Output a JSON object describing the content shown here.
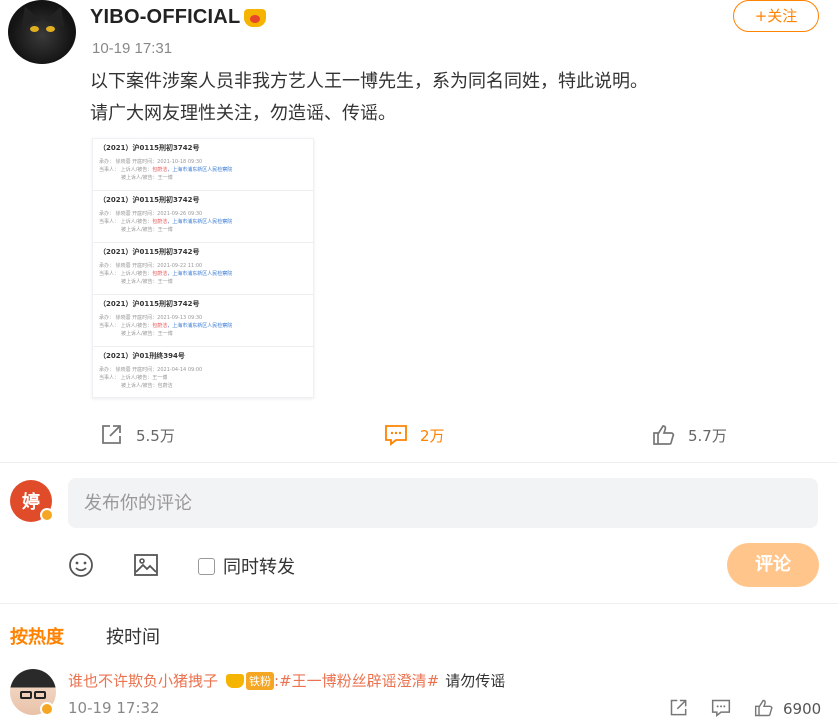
{
  "post": {
    "author": "YIBO-OFFICIAL",
    "time": "10-19 17:31",
    "follow_label": "+关注",
    "text_line1": "以下案件涉案人员非我方艺人王一博先生，系为同名同姓，特此说明。",
    "text_line2": "请广大网友理性关注，勿造谣、传谣。",
    "cases": [
      {
        "title": "（2021）沪0115刑初3742号",
        "l1": "承办：  徐晓蓉      开庭时间：2021-10-18 09:30",
        "l2a": "当事人：      上诉人/被告：",
        "l2b": "包蔚洁",
        "l2c": "，上海市浦东新区人民检察院",
        "l3": "被上诉人/被告：王一博"
      },
      {
        "title": "（2021）沪0115刑初3742号",
        "l1": "承办：  徐晓蓉      开庭时间：2021-09-26 09:30",
        "l2a": "当事人：      上诉人/被告：",
        "l2b": "包蔚洁",
        "l2c": "，上海市浦东新区人民检察院",
        "l3": "被上诉人/被告：王一博"
      },
      {
        "title": "（2021）沪0115刑初3742号",
        "l1": "承办：  徐晓蓉      开庭时间：2021-09-22 11:00",
        "l2a": "当事人：      上诉人/被告：",
        "l2b": "包蔚洁",
        "l2c": "，上海市浦东新区人民检察院",
        "l3": "被上诉人/被告：王一博"
      },
      {
        "title": "（2021）沪0115刑初3742号",
        "l1": "承办：  徐晓蓉      开庭时间：2021-09-13 09:30",
        "l2a": "当事人：      上诉人/被告：",
        "l2b": "包蔚洁",
        "l2c": "，上海市浦东新区人民检察院",
        "l3": "被上诉人/被告：王一博"
      },
      {
        "title": "（2021）沪01刑终394号",
        "l1": "承办：  徐晓蓉      开庭时间：2021-04-14 09:00",
        "l2a": "当事人：      上诉人/被告：王一博",
        "l2b": "",
        "l2c": "",
        "l3": "被上诉人/被告：包蔚洁"
      }
    ],
    "shares": "5.5万",
    "comments": "2万",
    "likes": "5.7万"
  },
  "composer": {
    "placeholder": "发布你的评论",
    "repost_label": "同时转发",
    "submit_label": "评论",
    "avatar_char": "婷"
  },
  "sort": {
    "hot_label": "按热度",
    "time_label": "按时间"
  },
  "top_comment": {
    "user": "谁也不许欺负小猪拽子",
    "fan_badge": "铁粉",
    "hashtag": ":#王一博粉丝辟谣澄清#",
    "text": "请勿传谣",
    "time": "10-19 17:32",
    "likes": "6900"
  },
  "colors": {
    "accent": "#ff8200",
    "link": "#eb7350",
    "submit_disabled": "#ffc58a"
  }
}
